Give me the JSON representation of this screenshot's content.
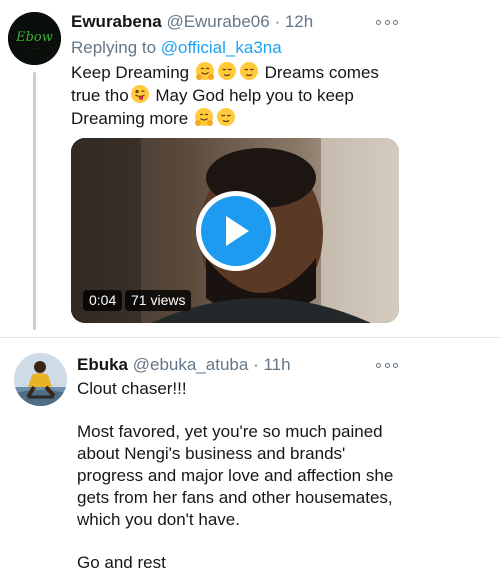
{
  "tweets": [
    {
      "name": "Ewurabena",
      "handle": "@Ewurabe06",
      "separator": "·",
      "time": "12h",
      "replying_prefix": "Replying to ",
      "replying_mention": "@official_ka3na",
      "line1_a": "Keep Dreaming",
      "line1_b": "Dreams comes",
      "line2_a": "true tho",
      "line2_b": "May God help you to keep",
      "line3_a": "Dreaming more",
      "video": {
        "duration": "0:04",
        "views": "71 views"
      },
      "avatar_text": "Ebow"
    },
    {
      "name": "Ebuka",
      "handle": "@ebuka_atuba",
      "separator": "·",
      "time": "11h",
      "paragraphs": [
        "Clout chaser!!!",
        "Most favored, yet you're so much pained",
        "about Nengi's business and brands'",
        "progress and major love and affection she",
        "gets from her fans and other housemates,",
        "which you don't have.",
        "Go and rest"
      ]
    }
  ],
  "icons": [
    "hug-emoji",
    "relieved-emoji",
    "winking-tongue-emoji",
    "play-icon",
    "more-options-icon"
  ],
  "colors": {
    "accent": "#1da1f2",
    "muted": "#657786",
    "thread": "#c4cfd6"
  }
}
